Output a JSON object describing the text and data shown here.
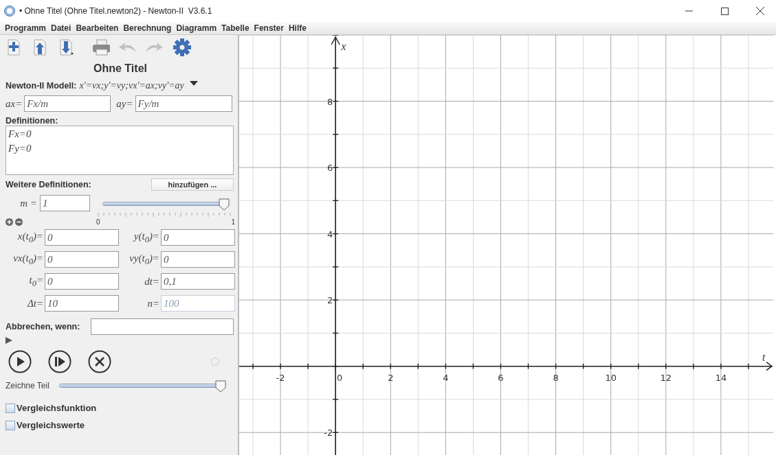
{
  "window": {
    "title": "• Ohne Titel (Ohne Titel.newton2) - Newton-II  V3.6.1"
  },
  "menu": [
    "Programm",
    "Datei",
    "Bearbeiten",
    "Berechnung",
    "Diagramm",
    "Tabelle",
    "Fenster",
    "Hilfe"
  ],
  "toolbar": [
    {
      "kind": "new",
      "disabled": false
    },
    {
      "kind": "open",
      "disabled": false
    },
    {
      "kind": "save",
      "disabled": false
    },
    {
      "kind": "print",
      "disabled": false
    },
    {
      "kind": "undo",
      "disabled": true
    },
    {
      "kind": "redo",
      "disabled": true
    },
    {
      "kind": "settings",
      "disabled": false
    }
  ],
  "document_title": "Ohne Titel",
  "model": {
    "label": "Newton-II Modell:",
    "formula": "x'=vx;y'=vy;vx'=ax;vy'=ay"
  },
  "equations": [
    {
      "label": "ax=",
      "value": "Fx/m"
    },
    {
      "label": "ay=",
      "value": "Fy/m"
    }
  ],
  "definitions": {
    "label": "Definitionen:",
    "lines": [
      "Fx=0",
      "Fy=0"
    ]
  },
  "more_definitions": {
    "label": "Weitere Definitionen:",
    "button": "hinzufügen ..."
  },
  "parameter": {
    "label": "m =",
    "value": "1",
    "level": 1,
    "min": "0",
    "max": "1"
  },
  "initial_values": [
    {
      "label": "x(t$_{0}$)=",
      "value": "0",
      "disabled": false
    },
    {
      "label": "y(t$_{0}$)=",
      "value": "0",
      "disabled": false
    },
    {
      "label": "vx(t$_{0}$)=",
      "value": "0",
      "disabled": false
    },
    {
      "label": "vy(t$_{0}$)=",
      "value": "0",
      "disabled": false
    },
    {
      "label": "t$_{0}$=",
      "value": "0",
      "disabled": false
    },
    {
      "label": "dt=",
      "value": "0,1",
      "disabled": false
    },
    {
      "label": "Δt=",
      "value": "10",
      "disabled": false
    },
    {
      "label": "n=",
      "value": "100",
      "disabled": true
    }
  ],
  "abort": {
    "label": "Abbrechen, wenn:"
  },
  "draw_part": {
    "label": "Zeichne Teil",
    "level": 1
  },
  "options": [
    {
      "label": "Vergleichsfunktion",
      "checked": false
    },
    {
      "label": "Vergleichswerte",
      "checked": false
    }
  ],
  "chart_data": {
    "type": "line",
    "grid": true,
    "xlabel": "t",
    "ylabel": "x",
    "xlim": [
      -3.5,
      15.9
    ],
    "ylim": [
      -2.7,
      10
    ],
    "xticks": [
      -2,
      0,
      2,
      4,
      6,
      8,
      10,
      12,
      14
    ],
    "yticks": [
      -2,
      2,
      4,
      6,
      8
    ]
  }
}
